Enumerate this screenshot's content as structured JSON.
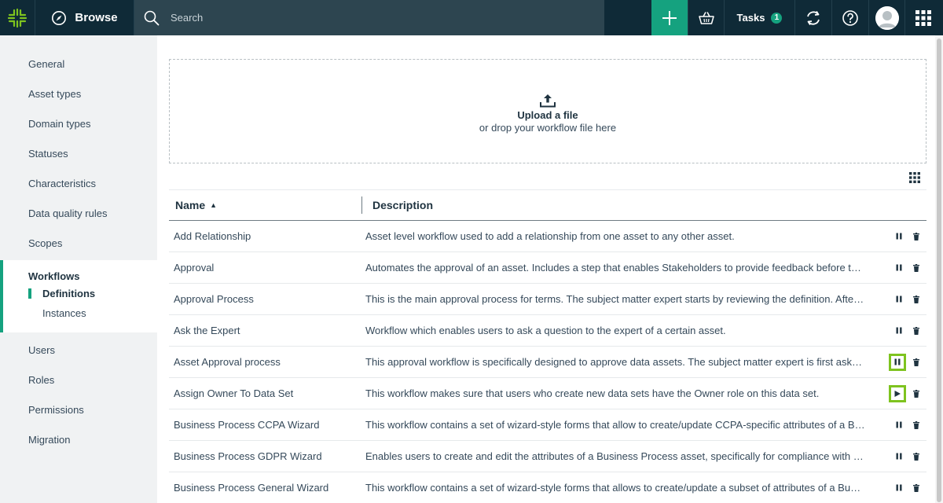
{
  "topbar": {
    "browse_label": "Browse",
    "search_placeholder": "Search",
    "tasks_label": "Tasks",
    "tasks_count": "1"
  },
  "sidebar": {
    "items_top": [
      "General",
      "Asset types",
      "Domain types",
      "Statuses",
      "Characteristics",
      "Data quality rules",
      "Scopes"
    ],
    "active_section": "Workflows",
    "sub_items": [
      "Definitions",
      "Instances"
    ],
    "items_bottom": [
      "Users",
      "Roles",
      "Permissions",
      "Migration"
    ]
  },
  "upload": {
    "title": "Upload a file",
    "subtitle": "or drop your workflow file here"
  },
  "table": {
    "col_name": "Name",
    "col_description": "Description",
    "rows": [
      {
        "name": "Add Relationship",
        "description": "Asset level workflow used to add a relationship from one asset to any other asset.",
        "state": "pause",
        "highlight": false
      },
      {
        "name": "Approval",
        "description": "Automates the approval of an asset. Includes a step that enables Stakeholders to provide feedback before the …",
        "state": "pause",
        "highlight": false
      },
      {
        "name": "Approval Process",
        "description": "This is the main approval process for terms. The subject matter expert starts by reviewing the definition. After t…",
        "state": "pause",
        "highlight": false
      },
      {
        "name": "Ask the Expert",
        "description": "Workflow which enables users to ask a question to the expert of a certain asset.",
        "state": "pause",
        "highlight": false
      },
      {
        "name": "Asset Approval process",
        "description": "This approval workflow is specifically designed to approve data assets. The subject matter expert is first asked t…",
        "state": "pause",
        "highlight": true
      },
      {
        "name": "Assign Owner To Data Set",
        "description": "This workflow makes sure that users who create new data sets have the Owner role on this data set.",
        "state": "play",
        "highlight": true
      },
      {
        "name": "Business Process CCPA Wizard",
        "description": "This workflow contains a set of wizard-style forms that allow to create/update CCPA-specific attributes of a Busines",
        "state": "pause",
        "highlight": false
      },
      {
        "name": "Business Process GDPR Wizard",
        "description": "Enables users to create and edit the attributes of a Business Process asset, specifically for compliance with GDP…",
        "state": "pause",
        "highlight": false
      },
      {
        "name": "Business Process General Wizard",
        "description": "This workflow contains a set of wizard-style forms that allows to create/update a subset of attributes of a Business",
        "state": "pause",
        "highlight": false
      }
    ]
  },
  "colors": {
    "topbar_bg": "#0f2a37",
    "search_bg": "#2d4550",
    "accent": "#15a27f",
    "highlight": "#7ec31f",
    "sidebar_bg": "#f0f2f3"
  }
}
